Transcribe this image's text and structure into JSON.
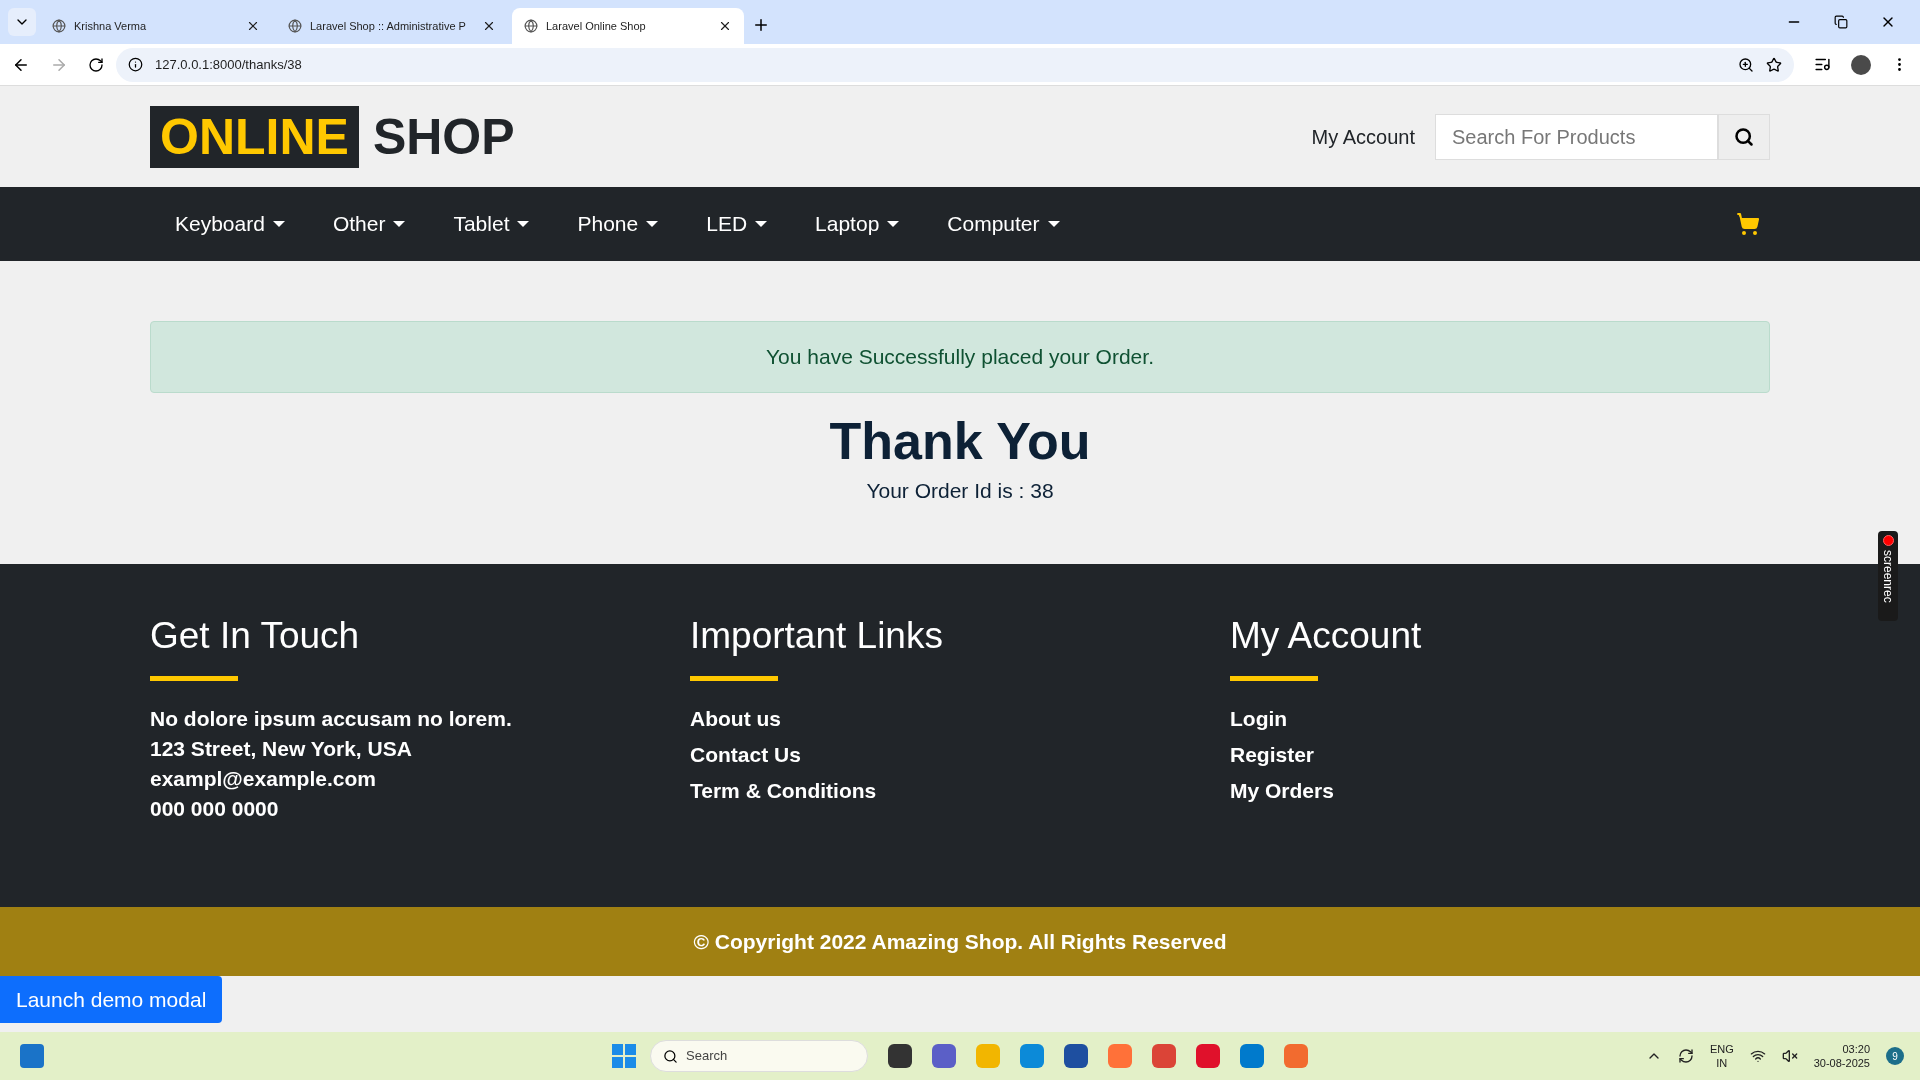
{
  "browser": {
    "tabs": [
      {
        "title": "Krishna Verma",
        "selected": false
      },
      {
        "title": "Laravel Shop :: Administrative P",
        "selected": false
      },
      {
        "title": "Laravel Online Shop",
        "selected": true
      }
    ],
    "url": "127.0.0.1:8000/thanks/38"
  },
  "header": {
    "logo": {
      "highlight": "ONLINE",
      "rest": "SHOP"
    },
    "account_link": "My Account",
    "search": {
      "placeholder": "Search For Products"
    }
  },
  "nav": {
    "items": [
      "Keyboard",
      "Other",
      "Tablet",
      "Phone",
      "LED",
      "Laptop",
      "Computer"
    ]
  },
  "alert": "You have Successfully placed your Order.",
  "thanks": {
    "title": "Thank You",
    "order_line": "Your Order Id is : 38"
  },
  "footer": {
    "columns": [
      {
        "title": "Get In Touch",
        "kind": "text",
        "lines": [
          "No dolore ipsum accusam no lorem.",
          "123 Street, New York, USA",
          "exampl@example.com",
          "000 000 0000"
        ]
      },
      {
        "title": "Important Links",
        "kind": "links",
        "lines": [
          "About us",
          "Contact Us",
          "Term & Conditions"
        ]
      },
      {
        "title": "My Account",
        "kind": "links",
        "lines": [
          "Login",
          "Register",
          "My Orders"
        ]
      }
    ],
    "copyright": "© Copyright 2022 Amazing Shop. All Rights Reserved"
  },
  "demo_button": "Launch demo modal",
  "screenrec": "screenrec",
  "taskbar": {
    "search": "Search",
    "language": [
      "ENG",
      "IN"
    ],
    "time": "03:20",
    "date": "30-08-2025",
    "notifications": "9"
  }
}
